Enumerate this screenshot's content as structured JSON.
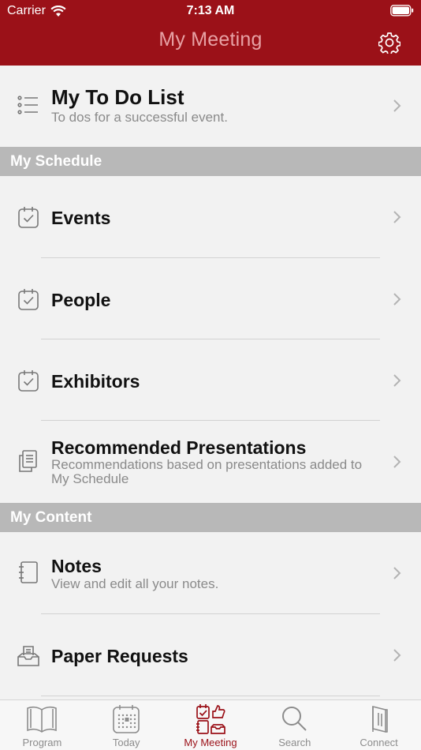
{
  "status_bar": {
    "carrier": "Carrier",
    "time": "7:13 AM"
  },
  "nav": {
    "title": "My Meeting",
    "settings_icon": "gear-icon"
  },
  "todo": {
    "title": "My To Do List",
    "subtitle": "To dos for a successful event."
  },
  "sections": [
    {
      "header": "My Schedule",
      "items": [
        {
          "title": "Events",
          "subtitle": ""
        },
        {
          "title": "People",
          "subtitle": ""
        },
        {
          "title": "Exhibitors",
          "subtitle": ""
        },
        {
          "title": "Recommended Presentations",
          "subtitle": "Recommendations based on presentations added to My Schedule"
        }
      ]
    },
    {
      "header": "My Content",
      "items": [
        {
          "title": "Notes",
          "subtitle": "View and edit all your notes."
        },
        {
          "title": "Paper Requests",
          "subtitle": ""
        }
      ]
    }
  ],
  "tabs": [
    {
      "label": "Program",
      "icon": "book-icon"
    },
    {
      "label": "Today",
      "icon": "calendar-icon"
    },
    {
      "label": "My Meeting",
      "icon": "my-meeting-icon",
      "active": true
    },
    {
      "label": "Search",
      "icon": "search-icon"
    },
    {
      "label": "Connect",
      "icon": "door-icon"
    }
  ],
  "colors": {
    "brand": "#9b1118",
    "title_inactive": "#e7a1a4",
    "section_header": "#b8b8b8"
  }
}
